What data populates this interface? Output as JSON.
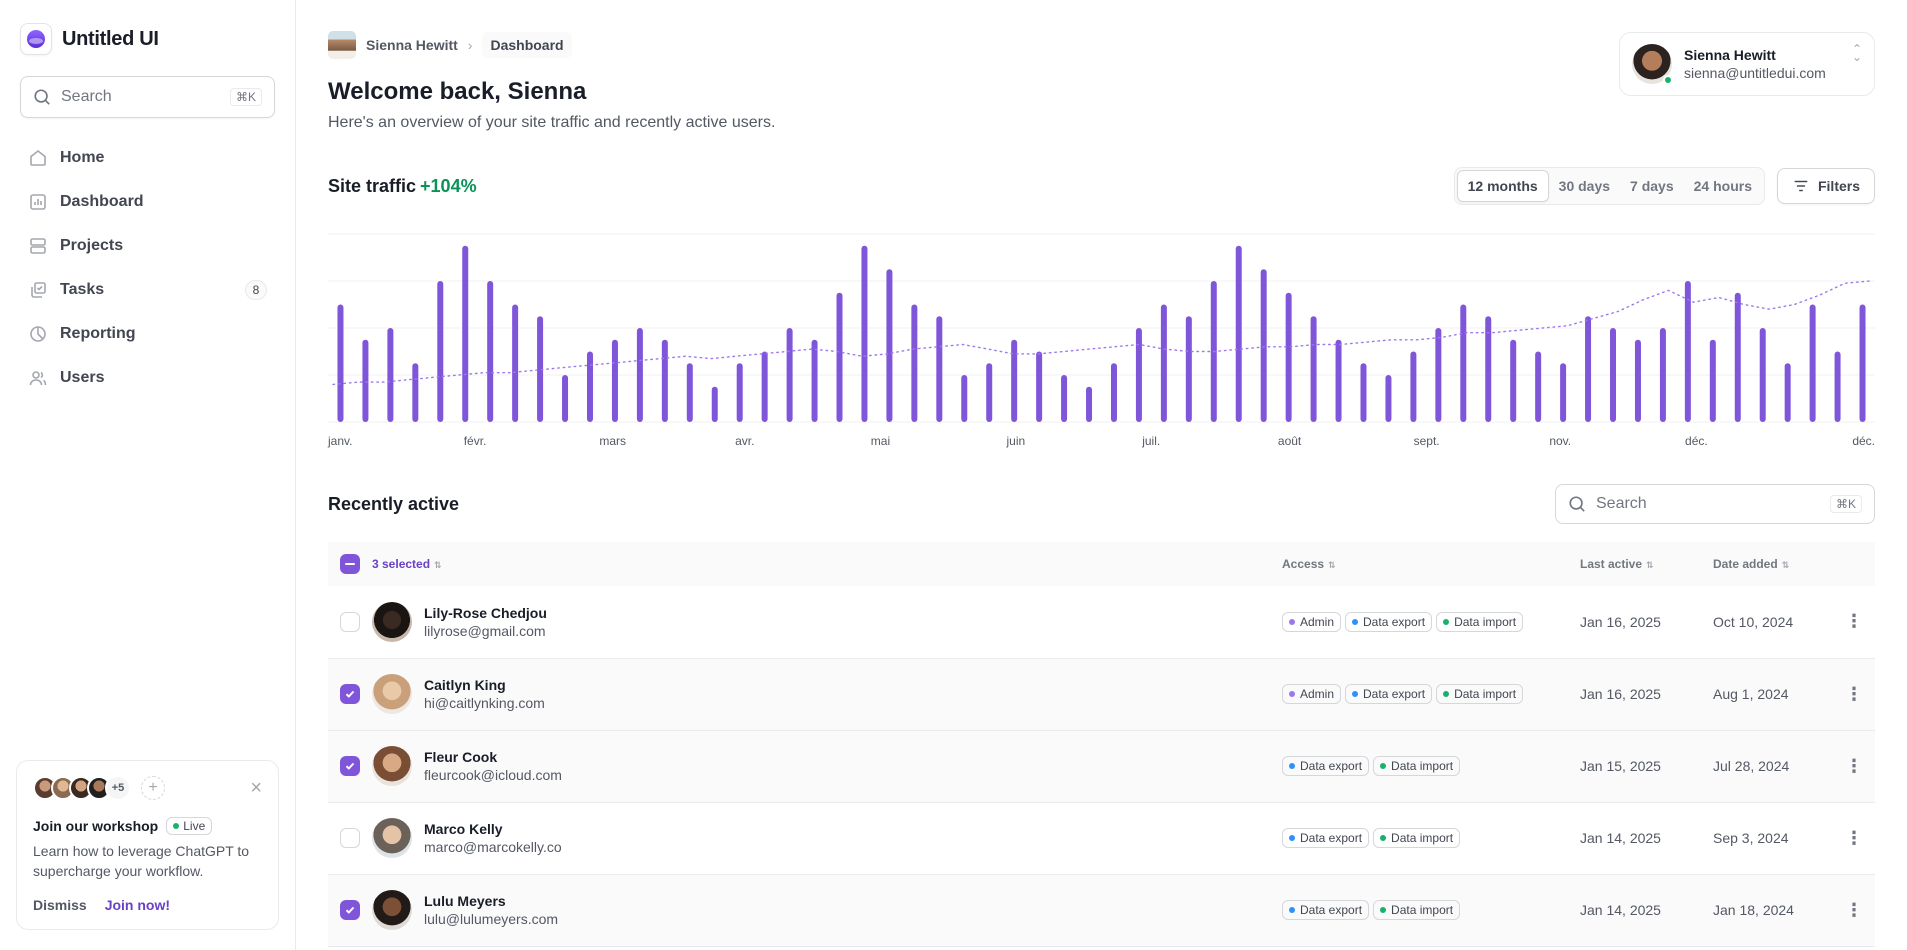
{
  "brand": {
    "name": "Untitled UI"
  },
  "sidebar": {
    "search_placeholder": "Search",
    "search_shortcut": "⌘K",
    "items": [
      {
        "label": "Home",
        "icon": "home-icon"
      },
      {
        "label": "Dashboard",
        "icon": "bar-chart-icon"
      },
      {
        "label": "Projects",
        "icon": "layers-icon"
      },
      {
        "label": "Tasks",
        "icon": "check-square-icon",
        "badge": "8"
      },
      {
        "label": "Reporting",
        "icon": "pie-chart-icon"
      },
      {
        "label": "Users",
        "icon": "users-icon"
      }
    ],
    "workshop": {
      "more_count": "+5",
      "title": "Join our workshop",
      "live_label": "Live",
      "text": "Learn how to leverage ChatGPT to supercharge your workflow.",
      "dismiss": "Dismiss",
      "join": "Join now!"
    }
  },
  "header": {
    "breadcrumb_user": "Sienna Hewitt",
    "breadcrumb_current": "Dashboard",
    "title": "Welcome back, Sienna",
    "subtitle": "Here's an overview of your site traffic and recently active users."
  },
  "account": {
    "name": "Sienna Hewitt",
    "email": "sienna@untitledui.com"
  },
  "traffic": {
    "title": "Site traffic",
    "change": "+104%",
    "ranges": [
      "12 months",
      "30 days",
      "7 days",
      "24 hours"
    ],
    "active_range": "12 months",
    "filters_label": "Filters"
  },
  "chart_data": {
    "type": "bar",
    "accent": "#7f56d9",
    "x_labels": [
      "janv.",
      "févr.",
      "mars",
      "avr.",
      "mai",
      "juin",
      "juil.",
      "août",
      "sept.",
      "nov.",
      "déc.",
      "déc."
    ],
    "ylim": [
      0,
      8
    ],
    "grid": true,
    "values": [
      5,
      3.5,
      4,
      2.5,
      6,
      7.5,
      6,
      5,
      4.5,
      2,
      3,
      3.5,
      4,
      3.5,
      2.5,
      1.5,
      2.5,
      3,
      4,
      3.5,
      5.5,
      7.5,
      6.5,
      5,
      4.5,
      2,
      2.5,
      3.5,
      3,
      2,
      1.5,
      2.5,
      4,
      5,
      4.5,
      6,
      7.5,
      6.5,
      5.5,
      4.5,
      3.5,
      2.5,
      2,
      3,
      4,
      5,
      4.5,
      3.5,
      3,
      2.5,
      4.5,
      4,
      3.5,
      4,
      6,
      3.5,
      5.5,
      4,
      2.5,
      5,
      3,
      5
    ],
    "trend": [
      1.6,
      1.7,
      1.7,
      1.8,
      1.9,
      2.0,
      2.1,
      2.1,
      2.2,
      2.3,
      2.4,
      2.5,
      2.6,
      2.7,
      2.8,
      2.7,
      2.8,
      2.9,
      3.0,
      3.1,
      3.0,
      2.8,
      2.9,
      3.1,
      3.2,
      3.3,
      3.1,
      2.9,
      2.9,
      3.0,
      3.1,
      3.2,
      3.3,
      3.1,
      3.0,
      3.0,
      3.1,
      3.2,
      3.2,
      3.3,
      3.3,
      3.4,
      3.5,
      3.5,
      3.6,
      3.8,
      3.8,
      3.9,
      4.0,
      4.1,
      4.4,
      4.7,
      5.2,
      5.6,
      5.1,
      5.3,
      5.0,
      4.8,
      5.0,
      5.4,
      5.9,
      6.0
    ]
  },
  "recent": {
    "title": "Recently active",
    "search_placeholder": "Search",
    "search_shortcut": "⌘K",
    "columns": {
      "selected": "3 selected",
      "access": "Access",
      "last_active": "Last active",
      "date_added": "Date added"
    },
    "rows": [
      {
        "name": "Lily-Rose Chedjou",
        "email": "lilyrose@gmail.com",
        "checked": false,
        "access": [
          "Admin",
          "Data export",
          "Data import"
        ],
        "last_active": "Jan 16, 2025",
        "date_added": "Oct 10, 2024"
      },
      {
        "name": "Caitlyn King",
        "email": "hi@caitlynking.com",
        "checked": true,
        "access": [
          "Admin",
          "Data export",
          "Data import"
        ],
        "last_active": "Jan 16, 2025",
        "date_added": "Aug 1, 2024"
      },
      {
        "name": "Fleur Cook",
        "email": "fleurcook@icloud.com",
        "checked": true,
        "access": [
          "Data export",
          "Data import"
        ],
        "last_active": "Jan 15, 2025",
        "date_added": "Jul 28, 2024"
      },
      {
        "name": "Marco Kelly",
        "email": "marco@marcokelly.co",
        "checked": false,
        "access": [
          "Data export",
          "Data import"
        ],
        "last_active": "Jan 14, 2025",
        "date_added": "Sep 3, 2024"
      },
      {
        "name": "Lulu Meyers",
        "email": "lulu@lulumeyers.com",
        "checked": true,
        "access": [
          "Data export",
          "Data import"
        ],
        "last_active": "Jan 14, 2025",
        "date_added": "Jan 18, 2024"
      }
    ],
    "access_colors": {
      "Admin": "#9e77ed",
      "Data export": "#2e90fa",
      "Data import": "#17b26a"
    }
  }
}
